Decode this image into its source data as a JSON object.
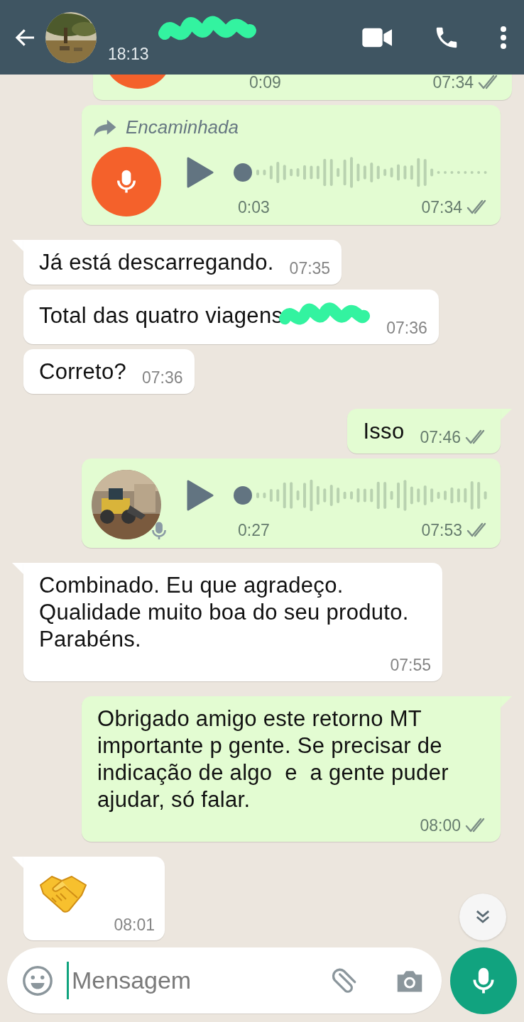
{
  "header": {
    "title_redacted": true,
    "subtitle": "18:13"
  },
  "messages": [
    {
      "kind": "voice_cut",
      "outgoing": true,
      "has_photo": false,
      "duration": "0:09",
      "time": "07:34",
      "read": false
    },
    {
      "kind": "voice",
      "outgoing": true,
      "forwarded_label": "Encaminhada",
      "has_photo": false,
      "duration": "0:03",
      "time": "07:34",
      "read": false
    },
    {
      "kind": "text",
      "outgoing": false,
      "text": "Já está descarregando.",
      "time": "07:35"
    },
    {
      "kind": "text",
      "outgoing": false,
      "text": "Total das quatro viagens",
      "redacted": true,
      "time": "07:36"
    },
    {
      "kind": "text",
      "outgoing": false,
      "text": "Correto?",
      "time": "07:36"
    },
    {
      "kind": "text",
      "outgoing": true,
      "text": "Isso",
      "time": "07:46",
      "read": false
    },
    {
      "kind": "voice",
      "outgoing": true,
      "has_photo": true,
      "duration": "0:27",
      "time": "07:53",
      "read": false
    },
    {
      "kind": "text",
      "outgoing": false,
      "text": "Combinado. Eu que agradeço.\nQualidade muito boa do seu produto.\nParabéns.",
      "time": "07:55"
    },
    {
      "kind": "text",
      "outgoing": true,
      "text": "Obrigado amigo este retorno MT importante p gente. Se precisar de indicação de algo  e  a gente puder ajudar, só falar.",
      "time": "08:00",
      "read": false
    },
    {
      "kind": "emoji",
      "outgoing": false,
      "time": "08:01"
    }
  ],
  "composer": {
    "placeholder": "Mensagem"
  }
}
